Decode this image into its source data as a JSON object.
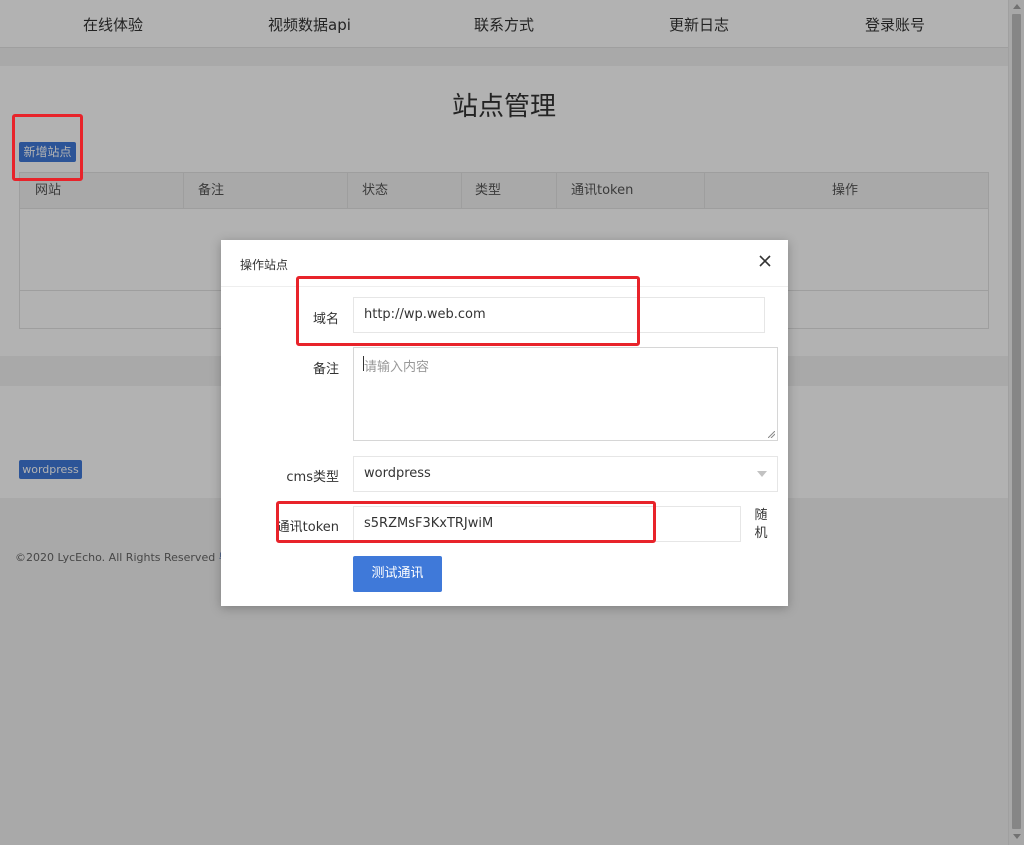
{
  "nav": {
    "items": [
      {
        "label": "在线体验"
      },
      {
        "label": "视频数据api"
      },
      {
        "label": "联系方式"
      },
      {
        "label": "更新日志"
      },
      {
        "label": "登录账号"
      }
    ]
  },
  "page": {
    "title": "站点管理",
    "add_button": "新增站点",
    "table": {
      "headers": [
        "网站",
        "备注",
        "状态",
        "类型",
        "通讯token",
        "操作"
      ]
    },
    "cms_badge": "wordpress",
    "footer": {
      "copyright": "©2020 LycEcho. All Rights Reserved",
      "icp": "粤I"
    }
  },
  "modal": {
    "title": "操作站点",
    "domain": {
      "label": "域名",
      "value": "http://wp.web.com"
    },
    "remark": {
      "label": "备注",
      "placeholder": "请输入内容"
    },
    "cms": {
      "label": "cms类型",
      "selected": "wordpress"
    },
    "token": {
      "label": "通讯token",
      "value": "s5RZMsF3KxTRJwiM"
    },
    "random_button": "随机",
    "test_button": "测试通讯"
  },
  "icons": {
    "close": "close-icon",
    "select_arrow": "chevron-down-icon",
    "resize": "resize-grip-icon"
  },
  "colors": {
    "primary": "#3f79d9",
    "annotation": "#e8232a",
    "overlay": "rgba(0,0,0,0.3)"
  }
}
